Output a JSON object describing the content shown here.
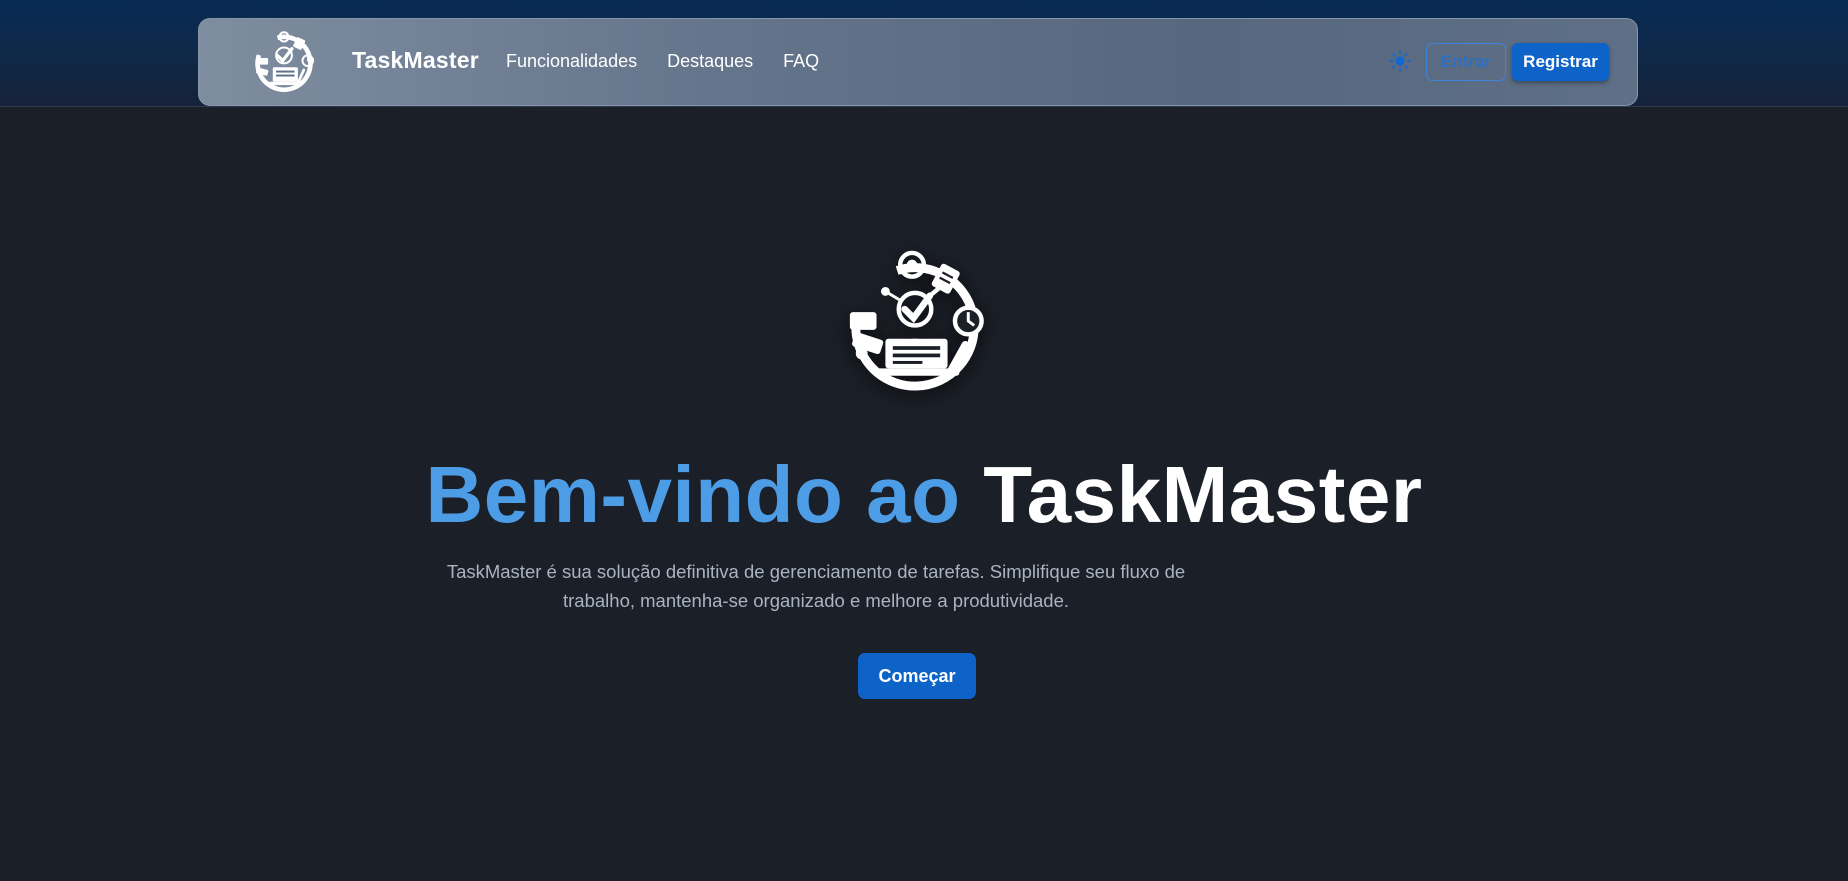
{
  "app": {
    "brand": "TaskMaster",
    "logo_icon": "taskmaster-productivity-logo-icon"
  },
  "nav": {
    "links": [
      "Funcionalidades",
      "Destaques",
      "FAQ"
    ],
    "theme_toggle_icon": "sun-icon",
    "login_label": "Entrar",
    "register_label": "Registrar"
  },
  "hero": {
    "title_accent": "Bem-vindo ao",
    "title_main": "TaskMaster",
    "subtitle": "TaskMaster é sua solução definitiva de gerenciamento de tarefas. Simplifique seu fluxo de trabalho, mantenha-se organizado e melhore a produtividade.",
    "cta_label": "Começar"
  },
  "colors": {
    "accent": "#4d9ce6",
    "primary_button": "#0e63c9",
    "background": "#1b1f27"
  }
}
